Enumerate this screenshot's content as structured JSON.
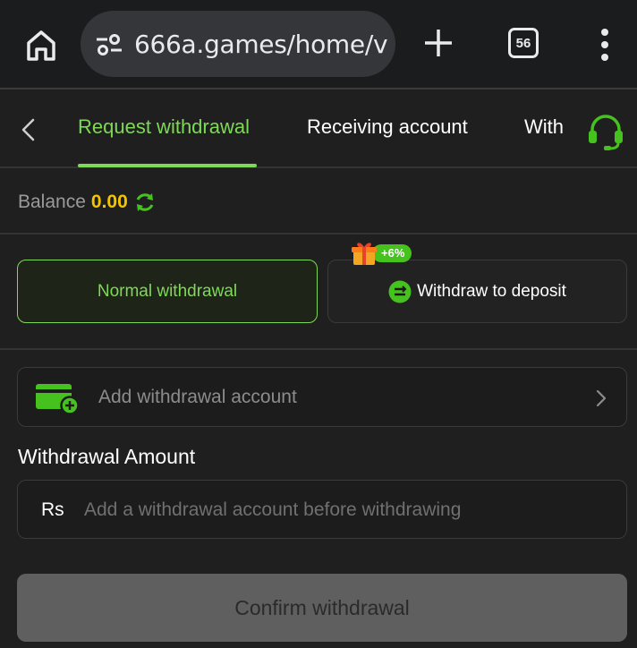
{
  "browser": {
    "url": "666a.games/home/v",
    "tab_count": "56"
  },
  "tabs": [
    {
      "label": "Request withdrawal",
      "active": true
    },
    {
      "label": "Receiving account",
      "active": false
    },
    {
      "label": "With",
      "active": false
    }
  ],
  "balance": {
    "label": "Balance",
    "value": "0.00"
  },
  "withdraw_types": {
    "normal": "Normal withdrawal",
    "deposit": "Withdraw to deposit",
    "bonus_badge": "+6%"
  },
  "account": {
    "add_label": "Add withdrawal account"
  },
  "amount": {
    "section_label": "Withdrawal Amount",
    "currency": "Rs",
    "placeholder": "Add a withdrawal account before withdrawing"
  },
  "confirm_label": "Confirm withdrawal",
  "colors": {
    "accent": "#7ed957",
    "balance": "#f5c400",
    "background": "#1f1f1f"
  },
  "icons": [
    "home-icon",
    "site-settings-icon",
    "plus-icon",
    "tab-switcher-icon",
    "more-vert-icon",
    "back-icon",
    "headset-icon",
    "refresh-icon",
    "exchange-icon",
    "gift-icon",
    "wallet-add-icon",
    "chevron-right-icon"
  ]
}
